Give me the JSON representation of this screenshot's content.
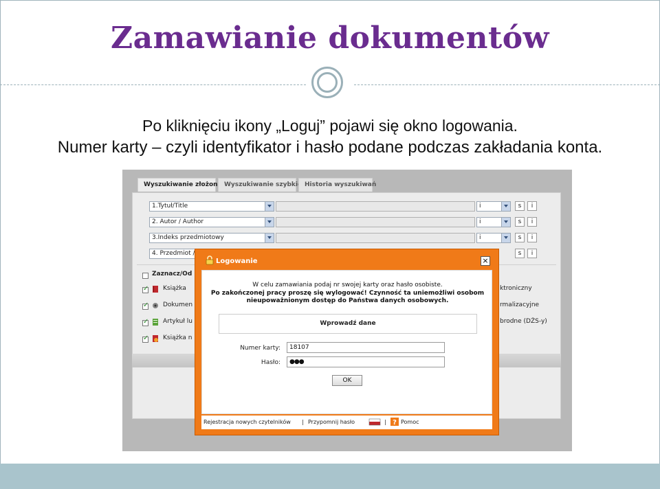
{
  "slide": {
    "title": "Zamawianie dokumentów",
    "caption_line1": "Po kliknięciu ikony „Loguj” pojawi się okno logowania.",
    "caption_line2": "Numer karty – czyli identyfikator i hasło podane podczas zakładania konta.",
    "colors": {
      "title": "#6a2c8f",
      "accent": "#a9c4cc",
      "dialog": "#f07a18"
    }
  },
  "search": {
    "tabs": [
      {
        "label": "Wyszukiwanie złożone"
      },
      {
        "label": "Wyszukiwanie szybkie"
      },
      {
        "label": "Historia wyszukiwań"
      }
    ],
    "rows": [
      {
        "field": "1.Tytuł/Title",
        "op": "i"
      },
      {
        "field": "2. Autor / Author",
        "op": "i"
      },
      {
        "field": "3.Indeks przedmiotowy",
        "op": "i"
      },
      {
        "field": "4. Przedmiot /",
        "op": ""
      }
    ],
    "row_buttons": {
      "s": "s",
      "i": "i"
    },
    "select_all_label": "Zaznacz/Od",
    "doc_types_left": [
      {
        "label": "Książka",
        "checked": true
      },
      {
        "label": "Dokumen",
        "checked": true
      },
      {
        "label": "Artykuł lu",
        "checked": true
      },
      {
        "label": "Książka n",
        "checked": true
      }
    ],
    "doc_types_right": [
      {
        "label": "ktroniczny"
      },
      {
        "label": "rmalizacyjne"
      },
      {
        "label": "brodne (DŻS-y)"
      }
    ]
  },
  "dialog": {
    "title": "Logowanie",
    "close": "×",
    "info_line1": "W celu zamawiania podaj nr swojej karty oraz hasło osobiste.",
    "info_line2": "Po zakończonej pracy proszę się wylogować! Czynność ta uniemożliwi osobom",
    "info_line3": "nieupoważnionym dostęp do Państwa danych osobowych.",
    "header": "Wprowadź dane",
    "card_label": "Numer karty:",
    "card_value": "18107",
    "password_label": "Hasło:",
    "password_value": "●●●",
    "ok_label": "OK",
    "footer": {
      "register": "Rejestracja nowych czytelników",
      "separator1": "|",
      "remind": "Przypomnij hasło",
      "separator2": "|",
      "help": "Pomoc"
    }
  }
}
